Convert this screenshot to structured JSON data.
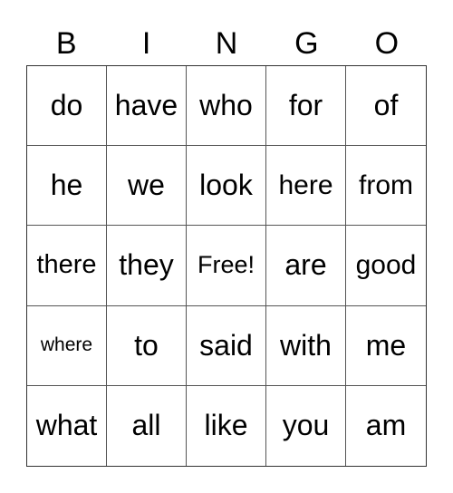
{
  "header": {
    "letters": [
      "B",
      "I",
      "N",
      "G",
      "O"
    ]
  },
  "card": {
    "cells": [
      "do",
      "have",
      "who",
      "for",
      "of",
      "he",
      "we",
      "look",
      "here",
      "from",
      "there",
      "they",
      "Free!",
      "are",
      "good",
      "where",
      "to",
      "said",
      "with",
      "me",
      "what",
      "all",
      "like",
      "you",
      "am"
    ]
  }
}
